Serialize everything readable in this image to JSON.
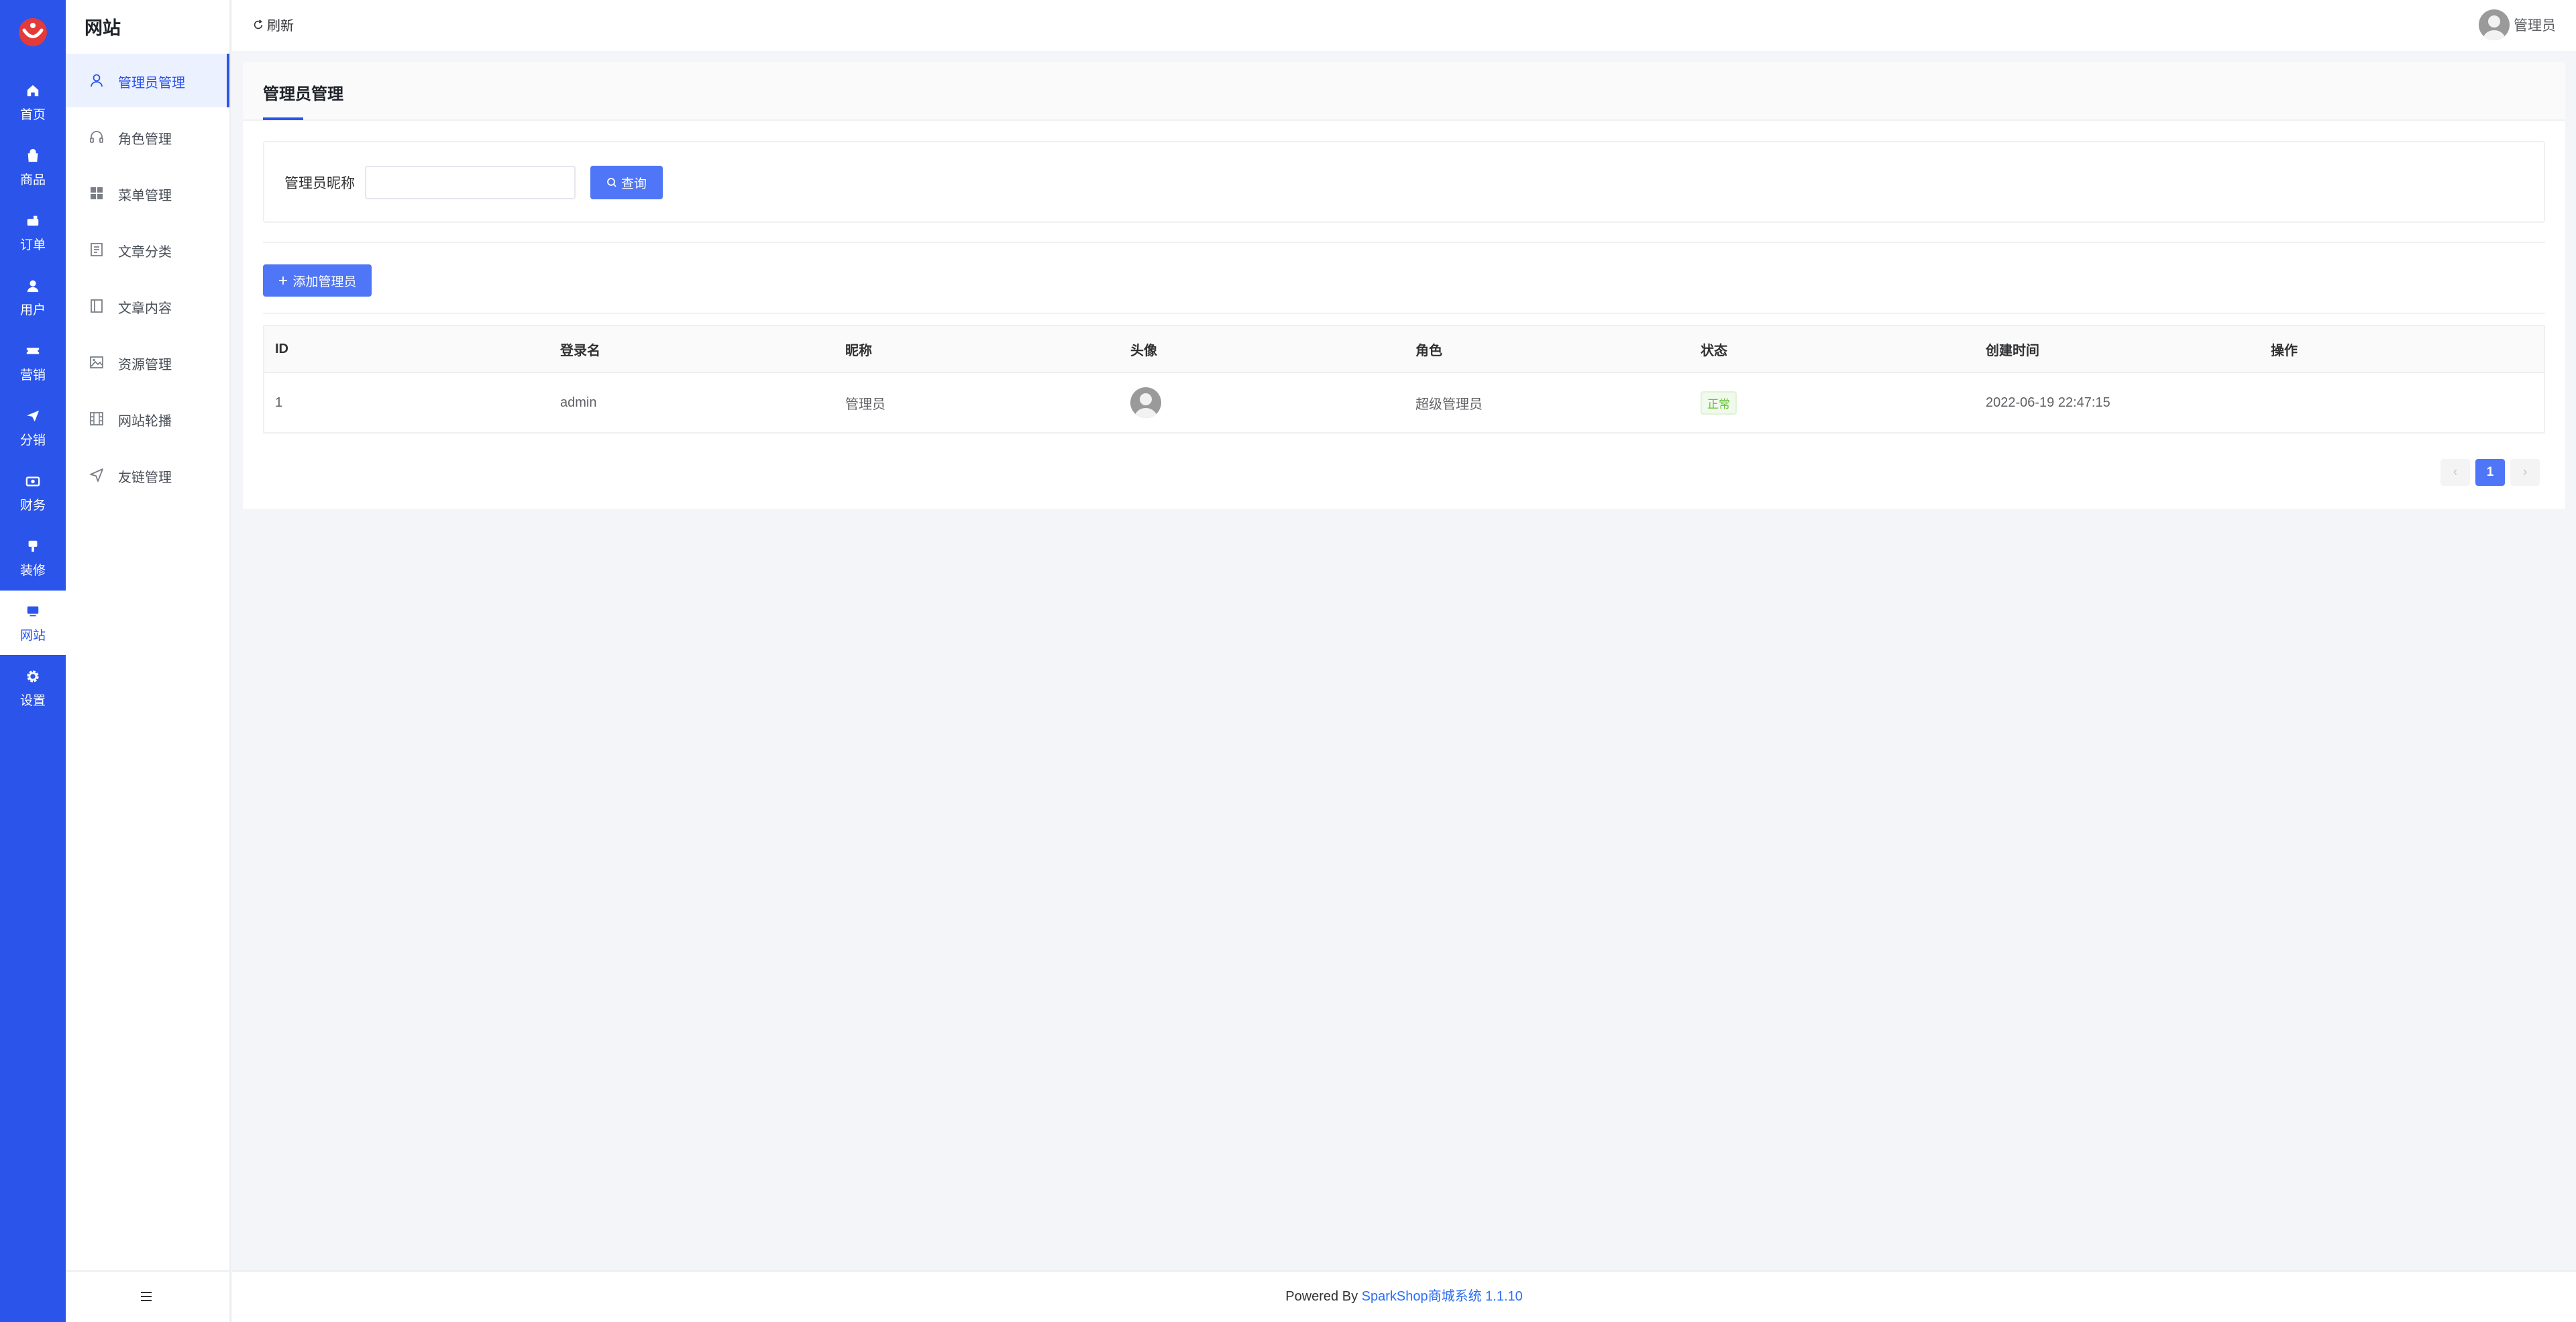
{
  "rail": {
    "items": [
      {
        "label": "首页",
        "icon": "home-icon"
      },
      {
        "label": "商品",
        "icon": "bag-icon"
      },
      {
        "label": "订单",
        "icon": "order-icon"
      },
      {
        "label": "用户",
        "icon": "user-icon"
      },
      {
        "label": "营销",
        "icon": "ticket-icon"
      },
      {
        "label": "分销",
        "icon": "send-icon"
      },
      {
        "label": "财务",
        "icon": "money-icon"
      },
      {
        "label": "装修",
        "icon": "brush-icon"
      },
      {
        "label": "网站",
        "icon": "monitor-icon"
      },
      {
        "label": "设置",
        "icon": "gear-icon"
      }
    ],
    "active_index": 8,
    "accent": "#2b54eb"
  },
  "sidebar": {
    "title": "网站",
    "items": [
      {
        "label": "管理员管理",
        "icon": "user-outline-icon"
      },
      {
        "label": "角色管理",
        "icon": "headset-icon"
      },
      {
        "label": "菜单管理",
        "icon": "grid-icon"
      },
      {
        "label": "文章分类",
        "icon": "list-doc-icon"
      },
      {
        "label": "文章内容",
        "icon": "book-icon"
      },
      {
        "label": "资源管理",
        "icon": "image-icon"
      },
      {
        "label": "网站轮播",
        "icon": "film-icon"
      },
      {
        "label": "友链管理",
        "icon": "navigation-icon"
      }
    ],
    "active_index": 0
  },
  "topbar": {
    "refresh_label": "刷新",
    "user_name": "管理员"
  },
  "page": {
    "title": "管理员管理",
    "filter_label": "管理员昵称",
    "filter_value": "",
    "search_label": "查询",
    "add_label": "添加管理员"
  },
  "table": {
    "columns": [
      "ID",
      "登录名",
      "昵称",
      "头像",
      "角色",
      "状态",
      "创建时间",
      "操作"
    ],
    "rows": [
      {
        "id": "1",
        "login": "admin",
        "nickname": "管理员",
        "role": "超级管理员",
        "status": "正常",
        "created": "2022-06-19 22:47:15"
      }
    ]
  },
  "pagination": {
    "current": "1",
    "prev": "‹",
    "next": "›"
  },
  "footer": {
    "prefix": "Powered By ",
    "link": "SparkShop商城系统 1.1.10"
  }
}
